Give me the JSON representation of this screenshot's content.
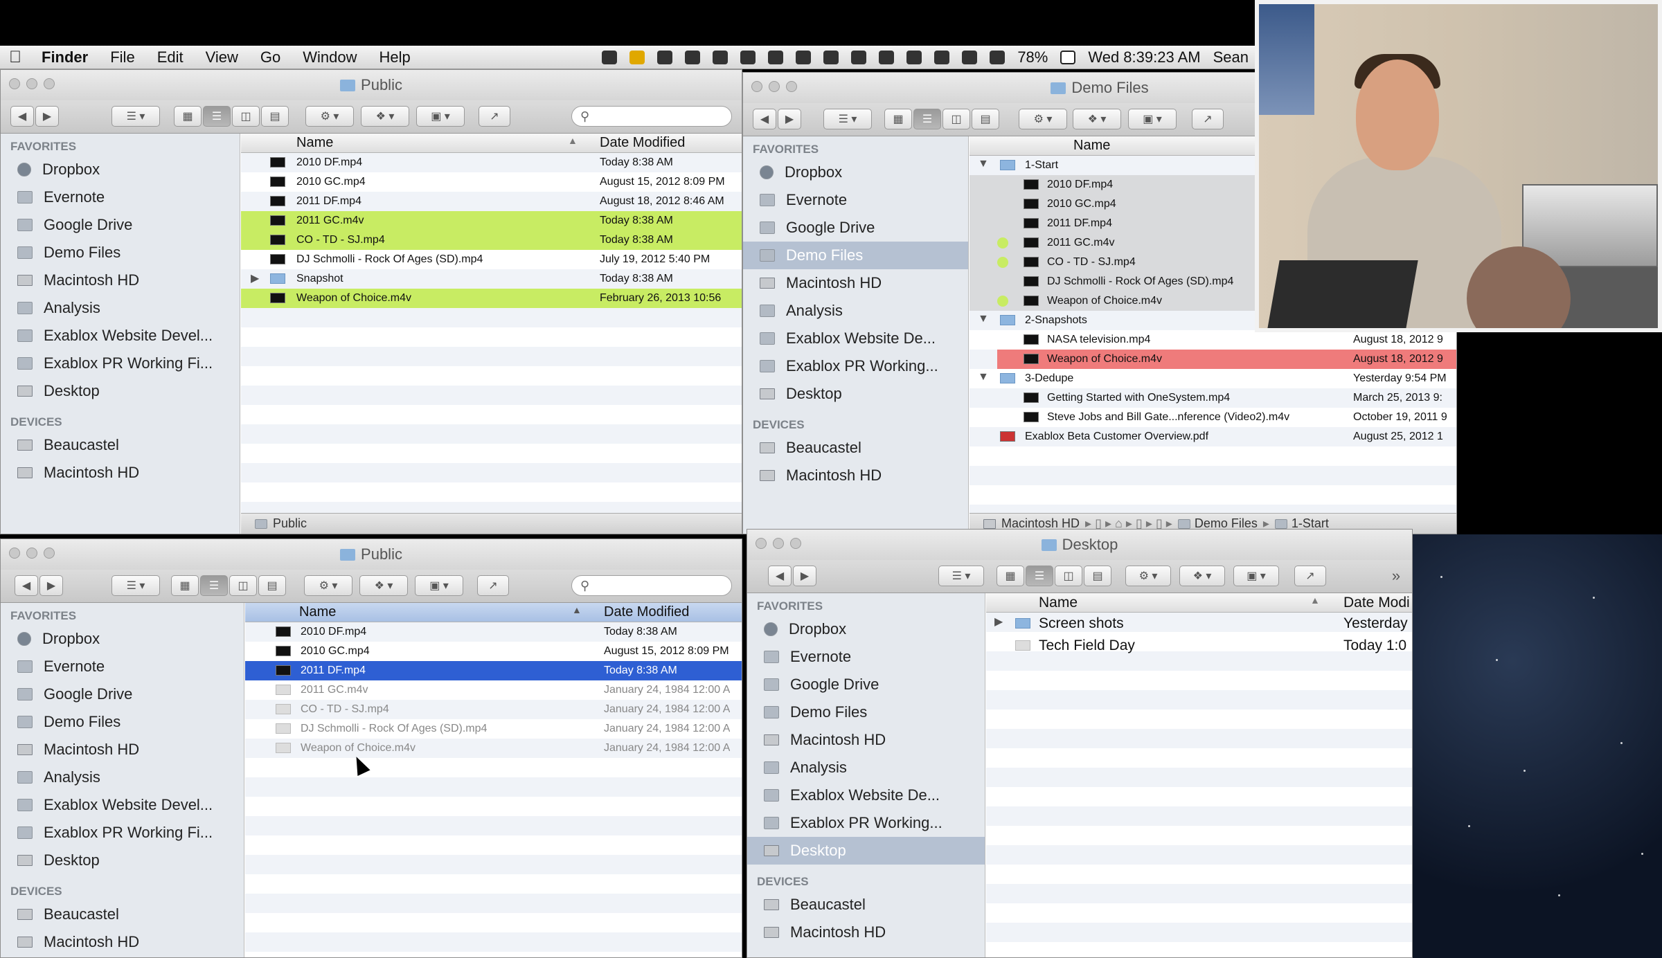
{
  "menubar": {
    "app": "Finder",
    "menus": [
      "File",
      "Edit",
      "View",
      "Go",
      "Window",
      "Help"
    ],
    "battery": "78%",
    "clock": "Wed 8:39:23 AM",
    "user": "Sean"
  },
  "sidebar_headers": {
    "favorites": "FAVORITES",
    "devices": "DEVICES"
  },
  "win_tl": {
    "title": "Public",
    "col_name": "Name",
    "col_date": "Date Modified",
    "favorites": [
      "Dropbox",
      "Evernote",
      "Google Drive",
      "Demo Files",
      "Macintosh HD",
      "Analysis",
      "Exablox Website Devel...",
      "Exablox PR Working Fi...",
      "Desktop"
    ],
    "devices": [
      "Beaucastel",
      "Macintosh HD"
    ],
    "files": [
      {
        "name": "2010 DF.mp4",
        "date": "Today 8:38 AM"
      },
      {
        "name": "2010 GC.mp4",
        "date": "August 15, 2012 8:09 PM"
      },
      {
        "name": "2011 DF.mp4",
        "date": "August 18, 2012 8:46 AM"
      },
      {
        "name": "2011 GC.m4v",
        "date": "Today 8:38 AM"
      },
      {
        "name": "CO - TD - SJ.mp4",
        "date": "Today 8:38 AM"
      },
      {
        "name": "DJ Schmolli - Rock Of Ages (SD).mp4",
        "date": "July 19, 2012 5:40 PM"
      },
      {
        "name": "Snapshot",
        "date": "Today 8:38 AM"
      },
      {
        "name": "Weapon of Choice.m4v",
        "date": "February 26, 2013 10:56"
      }
    ],
    "path": "Public"
  },
  "win_tr": {
    "title": "Demo Files",
    "col_name": "Name",
    "favorites": [
      "Dropbox",
      "Evernote",
      "Google Drive",
      "Demo Files",
      "Macintosh HD",
      "Analysis",
      "Exablox Website De...",
      "Exablox PR Working...",
      "Desktop"
    ],
    "devices": [
      "Beaucastel",
      "Macintosh HD"
    ],
    "files": [
      {
        "name": "1-Start",
        "date": ""
      },
      {
        "name": "2010 DF.mp4",
        "date": ""
      },
      {
        "name": "2010 GC.mp4",
        "date": ""
      },
      {
        "name": "2011 DF.mp4",
        "date": ""
      },
      {
        "name": "2011 GC.m4v",
        "date": ""
      },
      {
        "name": "CO - TD - SJ.mp4",
        "date": ""
      },
      {
        "name": "DJ Schmolli - Rock Of Ages (SD).mp4",
        "date": ""
      },
      {
        "name": "Weapon of Choice.m4v",
        "date": ""
      },
      {
        "name": "2-Snapshots",
        "date": ""
      },
      {
        "name": "NASA television.mp4",
        "date": "August 18, 2012 9"
      },
      {
        "name": "Weapon of Choice.m4v",
        "date": "August 18, 2012 9"
      },
      {
        "name": "3-Dedupe",
        "date": "Yesterday 9:54 PM"
      },
      {
        "name": "Getting Started with OneSystem.mp4",
        "date": "March 25, 2013 9:"
      },
      {
        "name": "Steve Jobs and Bill Gate...nference (Video2).m4v",
        "date": "October 19, 2011 9"
      },
      {
        "name": "Exablox Beta Customer Overview.pdf",
        "date": "August 25, 2012 1"
      }
    ],
    "path": [
      "Macintosh HD",
      "Demo Files",
      "1-Start"
    ]
  },
  "win_bl": {
    "title": "Public",
    "col_name": "Name",
    "col_date": "Date Modified",
    "favorites": [
      "Dropbox",
      "Evernote",
      "Google Drive",
      "Demo Files",
      "Macintosh HD",
      "Analysis",
      "Exablox Website Devel...",
      "Exablox PR Working Fi...",
      "Desktop"
    ],
    "devices": [
      "Beaucastel",
      "Macintosh HD"
    ],
    "files": [
      {
        "name": "2010 DF.mp4",
        "date": "Today 8:38 AM"
      },
      {
        "name": "2010 GC.mp4",
        "date": "August 15, 2012 8:09 PM"
      },
      {
        "name": "2011 DF.mp4",
        "date": "Today 8:38 AM"
      },
      {
        "name": "2011 GC.m4v",
        "date": "January 24, 1984 12:00 A"
      },
      {
        "name": "CO - TD - SJ.mp4",
        "date": "January 24, 1984 12:00 A"
      },
      {
        "name": "DJ Schmolli - Rock Of Ages (SD).mp4",
        "date": "January 24, 1984 12:00 A"
      },
      {
        "name": "Weapon of Choice.m4v",
        "date": "January 24, 1984 12:00 A"
      }
    ]
  },
  "win_br": {
    "title": "Desktop",
    "col_name": "Name",
    "col_date": "Date Modi",
    "favorites": [
      "Dropbox",
      "Evernote",
      "Google Drive",
      "Demo Files",
      "Macintosh HD",
      "Analysis",
      "Exablox Website De...",
      "Exablox PR Working...",
      "Desktop"
    ],
    "devices": [
      "Beaucastel",
      "Macintosh HD"
    ],
    "files": [
      {
        "name": "Screen shots",
        "date": "Yesterday"
      },
      {
        "name": "Tech Field Day",
        "date": "Today 1:0"
      }
    ]
  }
}
